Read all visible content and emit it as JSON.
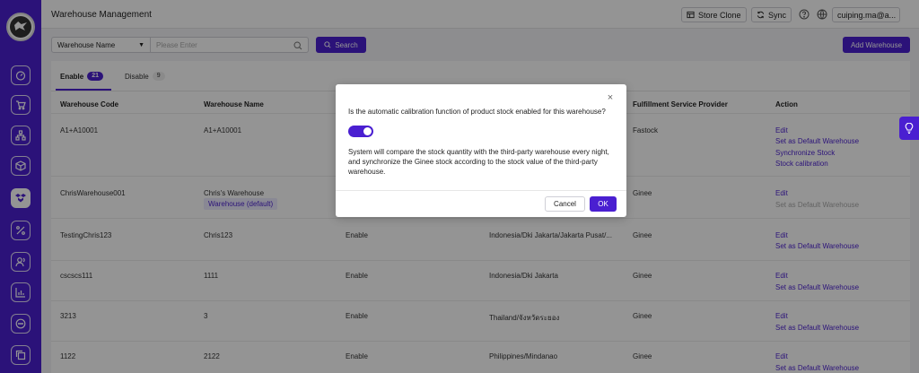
{
  "header": {
    "title": "Warehouse Management",
    "store_clone": "Store Clone",
    "sync": "Sync",
    "user": "cuiping.ma@a..."
  },
  "sidebar": {
    "items": [
      {
        "icon": "dashboard-icon"
      },
      {
        "icon": "cart-icon"
      },
      {
        "icon": "sitemap-icon"
      },
      {
        "icon": "box-icon"
      },
      {
        "icon": "warehouse-icon",
        "active": true
      },
      {
        "icon": "percent-icon"
      },
      {
        "icon": "users-icon"
      },
      {
        "icon": "chart-icon"
      },
      {
        "icon": "chat-icon"
      },
      {
        "icon": "copy-icon"
      }
    ]
  },
  "filter": {
    "select_value": "Warehouse Name",
    "placeholder": "Please Enter",
    "search_label": "Search",
    "add_label": "Add Warehouse"
  },
  "tabs": [
    {
      "label": "Enable",
      "count": "21"
    },
    {
      "label": "Disable",
      "count": "9"
    }
  ],
  "table": {
    "headers": {
      "code": "Warehouse Code",
      "name": "Warehouse Name",
      "provider": "Fulfillment Service Provider",
      "action": "Action"
    },
    "rows": [
      {
        "code": "A1+A10001",
        "name": "A1+A10001",
        "status": "",
        "location": "",
        "provider": "Fastock",
        "actions": [
          "Edit",
          "Set as Default Warehouse",
          "Synchronize Stock",
          "Stock calibration"
        ]
      },
      {
        "code": "ChrisWarehouse001",
        "name": "Chris's Warehouse",
        "tag": "Warehouse (default)",
        "status": "",
        "location": "",
        "provider": "Ginee",
        "actions": [
          "Edit",
          "Set as Default Warehouse"
        ]
      },
      {
        "code": "TestingChris123",
        "name": "Chris123",
        "status": "Enable",
        "location": "Indonesia/Dki Jakarta/Jakarta Pusat/...",
        "provider": "Ginee",
        "actions": [
          "Edit",
          "Set as Default Warehouse"
        ]
      },
      {
        "code": "cscscs111",
        "name": "1111",
        "status": "Enable",
        "location": "Indonesia/Dki Jakarta",
        "provider": "Ginee",
        "actions": [
          "Edit",
          "Set as Default Warehouse"
        ]
      },
      {
        "code": "3213",
        "name": "3",
        "status": "Enable",
        "location": "Thailand/จังหวัดระยอง",
        "provider": "Ginee",
        "actions": [
          "Edit",
          "Set as Default Warehouse"
        ]
      },
      {
        "code": "1122",
        "name": "2122",
        "status": "Enable",
        "location": "Philippines/Mindanao",
        "provider": "Ginee",
        "actions": [
          "Edit",
          "Set as Default Warehouse"
        ]
      }
    ]
  },
  "modal": {
    "question": "Is the automatic calibration function of product stock enabled for this warehouse?",
    "toggle_on": true,
    "description": "System will compare the stock quantity with the third-party warehouse every night, and synchronize the Ginee stock according to the stock value of the third-party warehouse.",
    "cancel": "Cancel",
    "ok": "OK",
    "close": "×"
  },
  "colors": {
    "accent": "#4a1fd1"
  }
}
